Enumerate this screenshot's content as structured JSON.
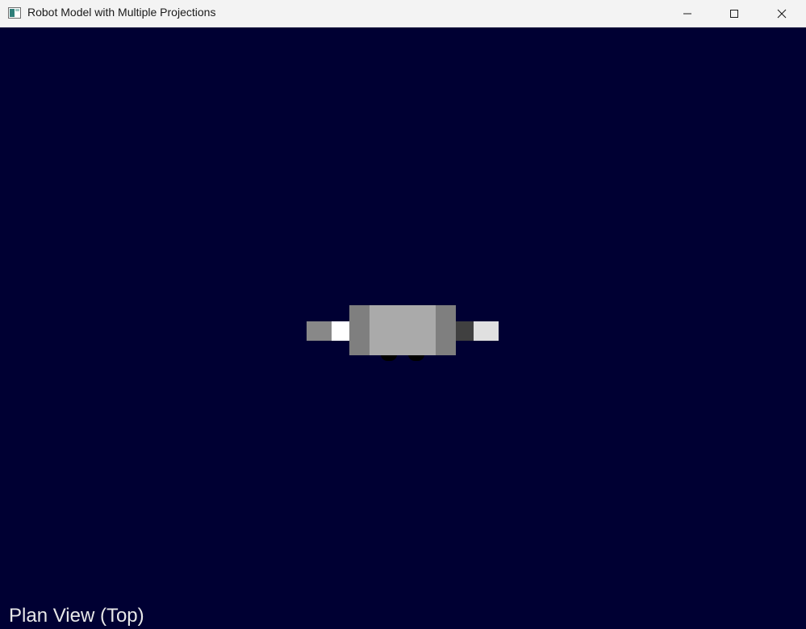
{
  "window": {
    "title": "Robot Model with Multiple Projections",
    "icon": "app-window-icon",
    "controls": {
      "minimize_icon": "minimize-icon",
      "maximize_icon": "maximize-icon",
      "close_icon": "close-icon"
    }
  },
  "viewport": {
    "background_color": "#000033",
    "view_label": "Plan View (Top)"
  },
  "robot": {
    "colors": {
      "left_arm": "#888888",
      "left_hand": "#ffffff",
      "shoulders": "#7f7f7f",
      "torso": "#aaaaaa",
      "right_shoulder_joint": "#404040",
      "right_hand": "#e0e0e0",
      "feet": "#000000"
    }
  }
}
